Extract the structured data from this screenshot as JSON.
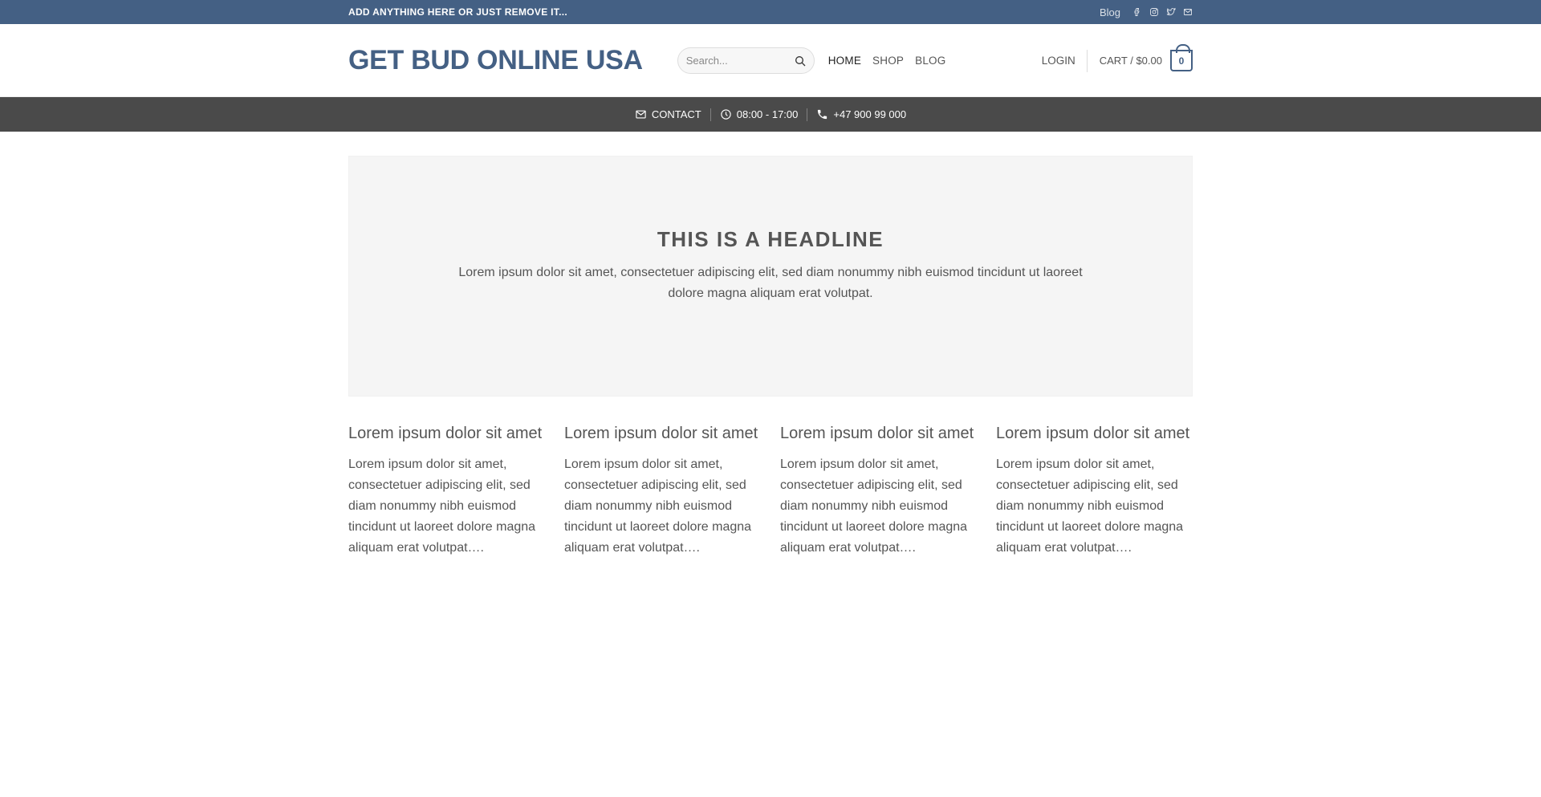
{
  "topbar": {
    "message": "ADD ANYTHING HERE OR JUST REMOVE IT...",
    "blog_link": "Blog",
    "social_icons": [
      "facebook-icon",
      "instagram-icon",
      "twitter-icon",
      "email-icon"
    ]
  },
  "header": {
    "logo": "GET BUD ONLINE USA",
    "search_placeholder": "Search...",
    "nav": [
      {
        "label": "HOME",
        "active": true
      },
      {
        "label": "SHOP",
        "active": false
      },
      {
        "label": "BLOG",
        "active": false
      }
    ],
    "login": "LOGIN",
    "cart_label": "CART / $0.00",
    "cart_count": "0"
  },
  "subbar": {
    "contact": "CONTACT",
    "hours": "08:00 - 17:00",
    "phone": "+47 900 99 000"
  },
  "hero": {
    "headline": "THIS IS A HEADLINE",
    "text": "Lorem ipsum dolor sit amet, consectetuer adipiscing elit, sed diam nonummy nibh euismod tincidunt ut laoreet dolore magna aliquam erat volutpat."
  },
  "columns": [
    {
      "title": "Lorem ipsum dolor sit amet",
      "text": "Lorem ipsum dolor sit amet, consectetuer adipiscing elit, sed diam nonummy nibh euismod tincidunt ut laoreet dolore magna aliquam erat volutpat…."
    },
    {
      "title": "Lorem ipsum dolor sit amet",
      "text": "Lorem ipsum dolor sit amet, consectetuer adipiscing elit, sed diam nonummy nibh euismod tincidunt ut laoreet dolore magna aliquam erat volutpat…."
    },
    {
      "title": "Lorem ipsum dolor sit amet",
      "text": "Lorem ipsum dolor sit amet, consectetuer adipiscing elit, sed diam nonummy nibh euismod tincidunt ut laoreet dolore magna aliquam erat volutpat…."
    },
    {
      "title": "Lorem ipsum dolor sit amet",
      "text": "Lorem ipsum dolor sit amet, consectetuer adipiscing elit, sed diam nonummy nibh euismod tincidunt ut laoreet dolore magna aliquam erat volutpat…."
    }
  ],
  "colors": {
    "primary": "#446084",
    "subbar_bg": "#4a4a4a",
    "hero_bg": "#f5f5f5"
  }
}
